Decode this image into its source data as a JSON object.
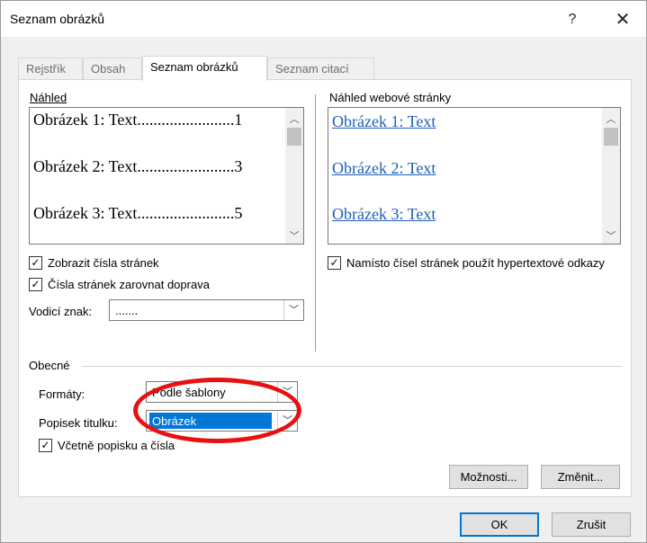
{
  "window": {
    "title": "Seznam obrázků",
    "help_label": "?",
    "close_label": "✕"
  },
  "tabs": [
    {
      "label": "Rejstřík",
      "active": false
    },
    {
      "label": "Obsah",
      "active": false
    },
    {
      "label": "Seznam obrázků",
      "active": true
    },
    {
      "label": "Seznam citací",
      "active": false
    }
  ],
  "print_preview": {
    "label": "Náhled",
    "lines": [
      "Obrázek 1: Text........................1",
      "Obrázek 2: Text........................3",
      "Obrázek 3: Text........................5"
    ]
  },
  "web_preview": {
    "label": "Náhled webové stránky",
    "links": [
      "Obrázek 1: Text",
      "Obrázek 2: Text",
      "Obrázek 3: Text"
    ]
  },
  "options": {
    "show_page_numbers": {
      "label": "Zobrazit čísla stránek",
      "checked": true
    },
    "right_align": {
      "label": "Čísla stránek zarovnat doprava",
      "checked": true
    },
    "leader": {
      "label": "Vodicí znak:",
      "value": "......."
    },
    "use_hyperlinks": {
      "label": "Namísto čísel stránek použít hypertextové odkazy",
      "checked": true
    }
  },
  "general": {
    "label": "Obecné",
    "formats": {
      "label": "Formáty:",
      "value": "Podle šablony"
    },
    "caption_label": {
      "label": "Popisek titulku:",
      "value": "Obrázek"
    },
    "include_label": {
      "label": "Včetně popisku a čísla",
      "checked": true
    }
  },
  "buttons": {
    "options": "Možnosti...",
    "modify": "Změnit...",
    "ok": "OK",
    "cancel": "Zrušit"
  },
  "icons": {
    "check": "✓",
    "scroll_up": "︿",
    "scroll_down": "﹀",
    "combo_arrow": "﹀"
  },
  "colors": {
    "link": "#1f5fb8",
    "selection": "#0078d7",
    "annotation": "#e81010"
  }
}
